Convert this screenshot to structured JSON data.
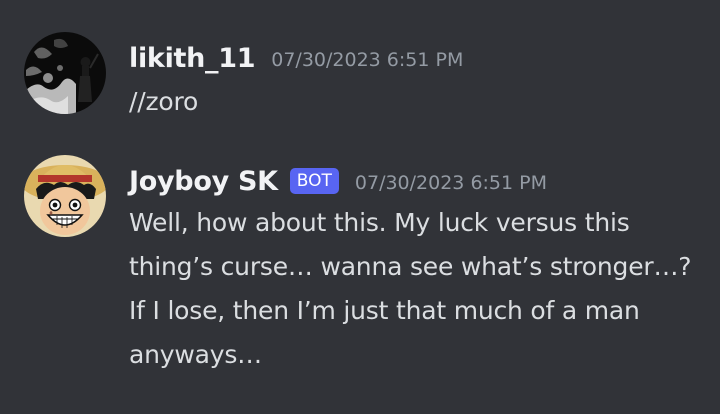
{
  "messages": [
    {
      "username": "likith_11",
      "timestamp": "07/30/2023 6:51 PM",
      "content": "//zoro",
      "avatar": "dark-smoky-figure-avatar",
      "is_bot": false
    },
    {
      "username": "Joyboy SK",
      "bot_tag": "BOT",
      "timestamp": "07/30/2023 6:51 PM",
      "content": "Well, how about this. My luck versus this thing’s curse… wanna see what’s stronger…? If I lose, then I’m just that much of a man anyways…",
      "avatar": "straw-hat-character-avatar",
      "is_bot": true
    }
  ],
  "colors": {
    "background": "#313338",
    "username": "#f2f3f5",
    "text": "#dbdee1",
    "timestamp": "#949ba4",
    "bot_tag": "#5865f2"
  }
}
